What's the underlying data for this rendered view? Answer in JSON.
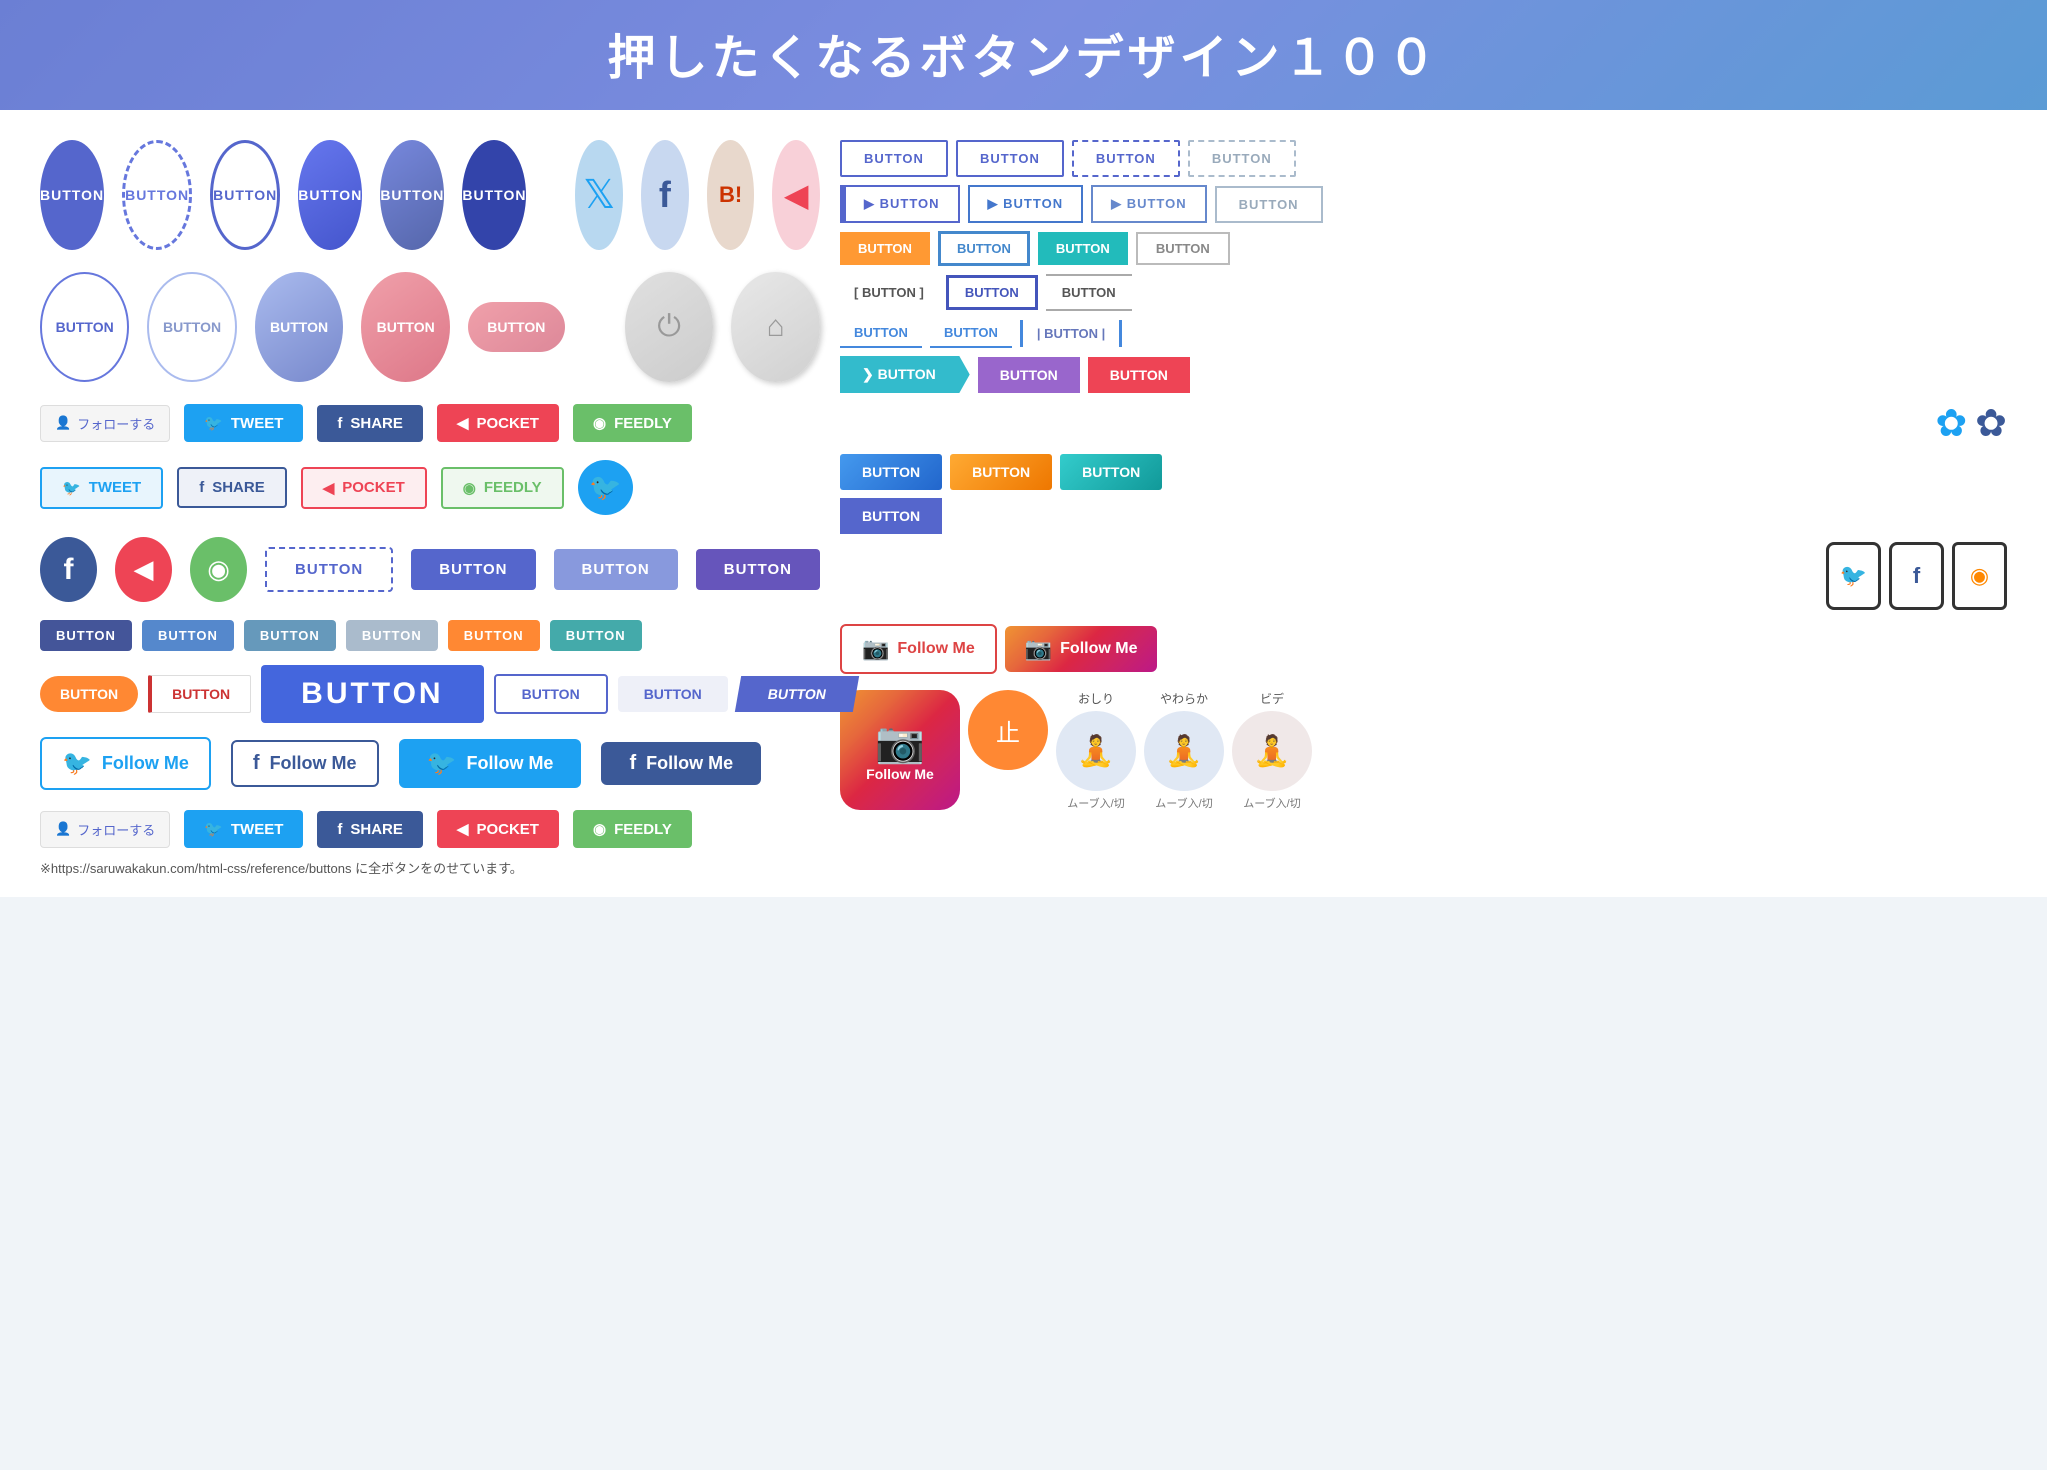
{
  "header": {
    "title": "押したくなるボタンデザイン１００"
  },
  "row1": {
    "buttons": [
      {
        "label": "BUTTON",
        "type": "solid"
      },
      {
        "label": "BUTTON",
        "type": "dashed"
      },
      {
        "label": "BUTTON",
        "type": "outline"
      },
      {
        "label": "BUTTON",
        "type": "grad1"
      },
      {
        "label": "BUTTON",
        "type": "grad2"
      },
      {
        "label": "BUTTON",
        "type": "dark"
      }
    ],
    "socials": [
      {
        "icon": "🐦",
        "type": "twitter"
      },
      {
        "icon": "f",
        "type": "facebook"
      },
      {
        "icon": "B!",
        "type": "hatena"
      },
      {
        "icon": "◀",
        "type": "pocket"
      }
    ]
  },
  "row2": {
    "buttons": [
      {
        "label": "BUTTON",
        "type": "outline-thin"
      },
      {
        "label": "BUTTON",
        "type": "outline-light"
      },
      {
        "label": "BUTTON",
        "type": "blue-grad"
      },
      {
        "label": "BUTTON",
        "type": "pink"
      },
      {
        "label": "BUTTON",
        "type": "pill-pink"
      }
    ]
  },
  "social_share": {
    "follow_label": "フォローする",
    "tweet_label": "TWEET",
    "share_label": "SHARE",
    "pocket_label": "POCKET",
    "feedly_label": "FEEDLY"
  },
  "follow_me": {
    "label": "Follow Me"
  },
  "right_panel": {
    "btn_label": "BUTTON"
  },
  "bottom_note": {
    "text": "※https://saruwakakun.com/html-css/reference/buttons に全ボタンをのせています。"
  },
  "animation_section": {
    "stop_label": "止",
    "oshiri_label": "おしり",
    "yawaraka_label": "やわらか",
    "bide_label": "ビデ",
    "move_label": "ムーブ入/切"
  },
  "insta": {
    "follow_label": "Follow Me",
    "large_label": "Follow Me"
  }
}
